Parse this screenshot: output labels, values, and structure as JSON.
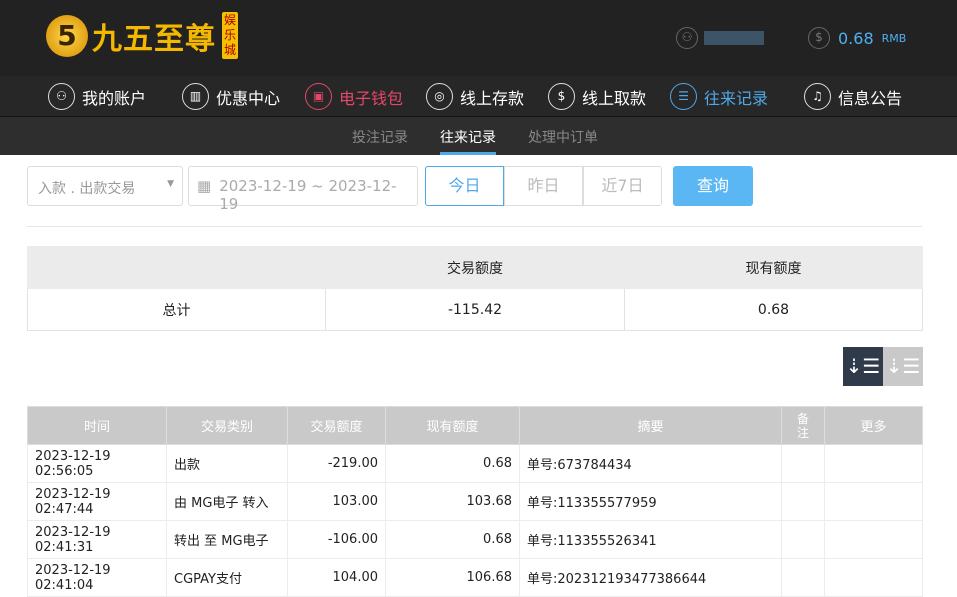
{
  "header": {
    "logo_text": "九五至尊",
    "logo_tag": "娱乐城",
    "balance": "0.68",
    "currency": "RMB"
  },
  "nav": [
    {
      "label": "我的账户"
    },
    {
      "label": "优惠中心"
    },
    {
      "label": "电子钱包"
    },
    {
      "label": "线上存款"
    },
    {
      "label": "线上取款"
    },
    {
      "label": "往来记录"
    },
    {
      "label": "信息公告"
    }
  ],
  "subnav": [
    {
      "label": "投注记录"
    },
    {
      "label": "往来记录"
    },
    {
      "label": "处理中订单"
    }
  ],
  "filters": {
    "type": "入款 . 出款交易",
    "date_range": "2023-12-19 ~ 2023-12-19",
    "quick": [
      "今日",
      "昨日",
      "近7日"
    ],
    "query": "查询"
  },
  "summary": {
    "headers": [
      "",
      "交易额度",
      "现有额度"
    ],
    "row": [
      "总计",
      "-115.42",
      "0.68"
    ]
  },
  "table": {
    "headers": [
      "时间",
      "交易类别",
      "交易额度",
      "现有额度",
      "摘要",
      "备注",
      "更多"
    ],
    "rows": [
      [
        "2023-12-19 02:56:05",
        "出款",
        "-219.00",
        "0.68",
        "单号:673784434",
        "",
        ""
      ],
      [
        "2023-12-19 02:47:44",
        "由 MG电子 转入",
        "103.00",
        "103.68",
        "单号:113355577959",
        "",
        ""
      ],
      [
        "2023-12-19 02:41:31",
        "转出 至 MG电子",
        "-106.00",
        "0.68",
        "单号:113355526341",
        "",
        ""
      ],
      [
        "2023-12-19 02:41:04",
        "CGPAY支付",
        "104.00",
        "106.68",
        "单号:202312193477386644",
        "",
        ""
      ]
    ]
  }
}
